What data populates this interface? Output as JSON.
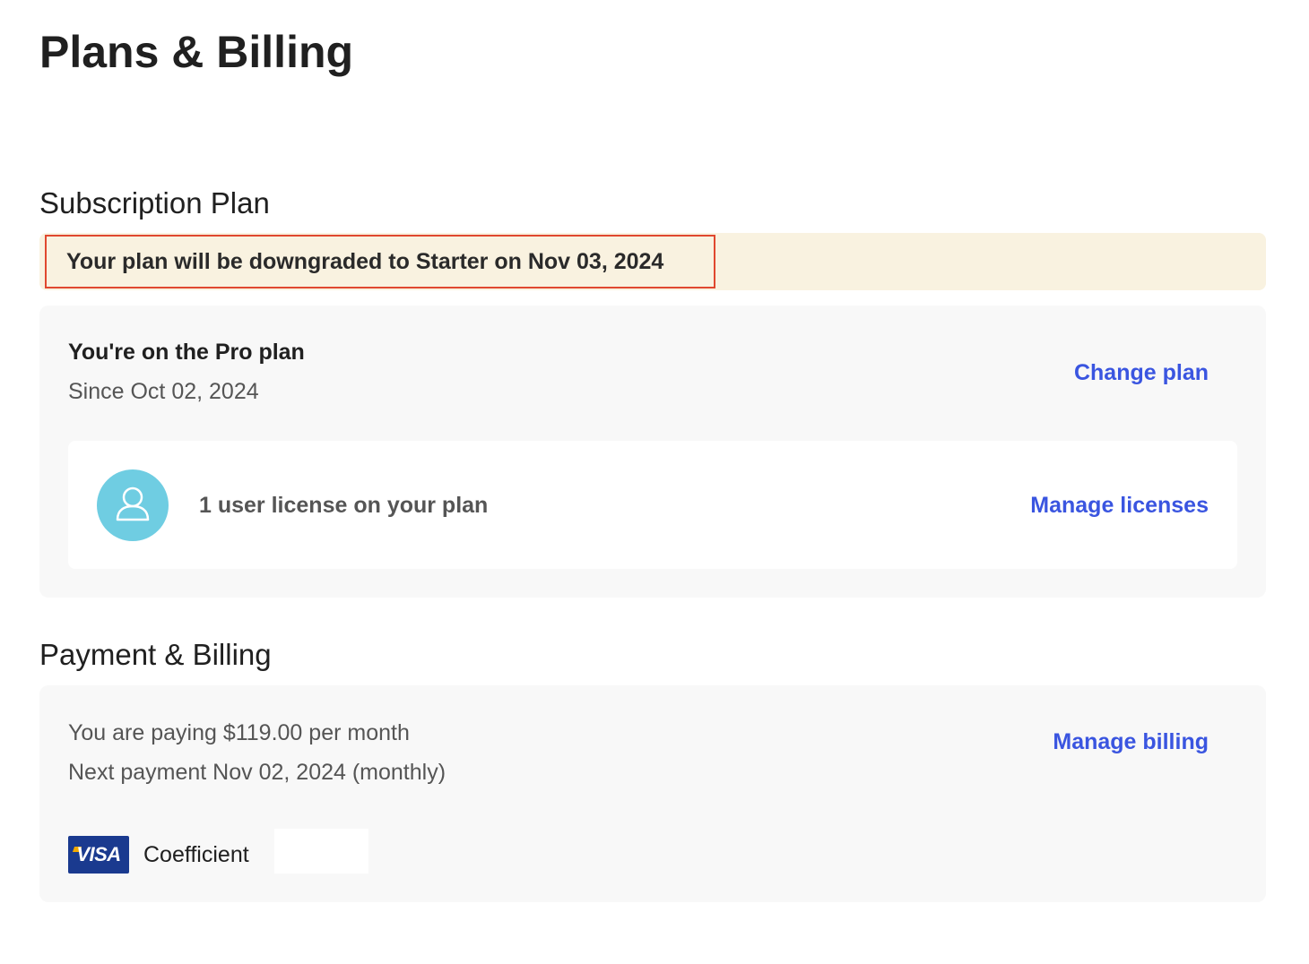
{
  "page": {
    "title": "Plans & Billing"
  },
  "subscription": {
    "section_title": "Subscription Plan",
    "notice": "Your plan will be downgraded to Starter on Nov 03, 2024",
    "plan_name": "You're on the Pro plan",
    "plan_since": "Since Oct 02, 2024",
    "change_plan_label": "Change plan",
    "licenses": {
      "text": "1 user license on your plan",
      "manage_label": "Manage licenses",
      "avatar_icon": "user-icon"
    }
  },
  "billing": {
    "section_title": "Payment & Billing",
    "paying": "You are paying $119.00 per month",
    "next_payment": "Next payment Nov 02, 2024 (monthly)",
    "manage_label": "Manage billing",
    "card": {
      "brand": "VISA",
      "holder": "Coefficient"
    }
  },
  "colors": {
    "link": "#3a55e0",
    "notice_bg": "#f9f2e0",
    "highlight_border": "#e0482f",
    "avatar_bg": "#6fcde2",
    "card_bg": "#f8f8f8",
    "visa_bg": "#1a3a8f"
  }
}
